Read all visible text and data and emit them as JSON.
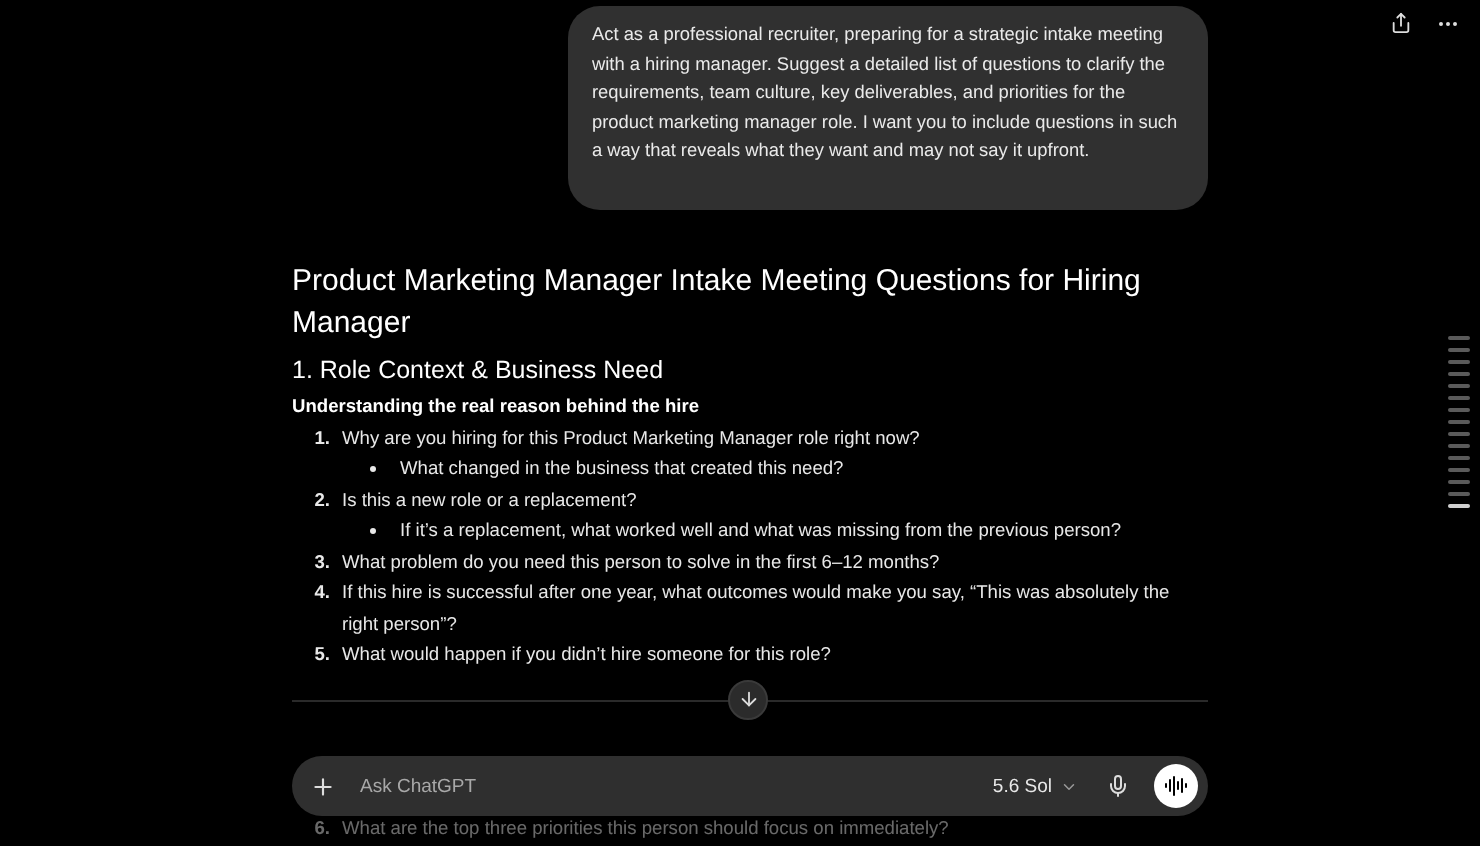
{
  "user_message": "Act as a professional recruiter, preparing for a strategic intake meeting with a hiring manager. Suggest a detailed list of questions to clarify the requirements, team culture, key deliverables, and priorities for the product marketing manager role. I want you to include questions in such a way that reveals what they want and may not say it upfront.",
  "response": {
    "title": "Product Marketing Manager Intake Meeting Questions for Hiring Manager",
    "section": "1. Role Context & Business Need",
    "subtitle": "Understanding the real reason behind the hire",
    "questions": [
      {
        "number": "1.",
        "text": "Why are you hiring for this Product Marketing Manager role right now?",
        "children": [
          {
            "text": "What changed in the business that created this need?"
          }
        ]
      },
      {
        "number": "2.",
        "text": "Is this a new role or a replacement?",
        "children": [
          {
            "text": "If it’s a replacement, what worked well and what was missing from the previous person?"
          }
        ]
      },
      {
        "number": "3.",
        "text": "What problem do you need this person to solve in the first 6–12 months?"
      },
      {
        "number": "4.",
        "text": "If this hire is successful after one year, what outcomes would make you say, “This was absolutely the right person”?"
      },
      {
        "number": "5.",
        "text": "What would happen if you didn’t hire someone for this role?"
      }
    ],
    "next_question": {
      "number": "6.",
      "text": "What are the top three priorities this person should focus on immediately?"
    }
  },
  "composer": {
    "placeholder": "Ask ChatGPT",
    "model": "5.6 Sol"
  },
  "nav_markers": [
    {
      "selected": false
    },
    {
      "selected": false
    },
    {
      "selected": false
    },
    {
      "selected": false
    },
    {
      "selected": false
    },
    {
      "selected": false
    },
    {
      "selected": false
    },
    {
      "selected": false
    },
    {
      "selected": false
    },
    {
      "selected": false
    },
    {
      "selected": false
    },
    {
      "selected": false
    },
    {
      "selected": false
    },
    {
      "selected": false
    },
    {
      "selected": true
    }
  ]
}
